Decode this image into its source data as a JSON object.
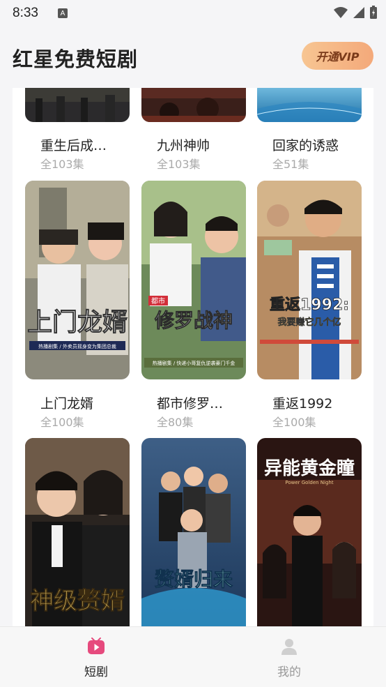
{
  "status_bar": {
    "time": "8:33",
    "notification_icon": "A"
  },
  "header": {
    "title": "红星免费短剧",
    "vip_button": "开通VIP"
  },
  "dramas": [
    {
      "title": "重生后成…",
      "episodes": "全103集"
    },
    {
      "title": "九州神帅",
      "episodes": "全103集"
    },
    {
      "title": "回家的诱惑",
      "episodes": "全51集"
    },
    {
      "title": "上门龙婿",
      "episodes": "全100集",
      "poster_text": "上门龙婿",
      "poster_caption": "热播剧集 / 外卖员摇身变为集团总裁"
    },
    {
      "title": "都市修罗…",
      "episodes": "全80集",
      "poster_text": "修罗战神",
      "poster_badge": "都市",
      "poster_caption": "热播剧集 / 快递小哥复仇逆袭豪门千金"
    },
    {
      "title": "重返1992",
      "episodes": "全100集",
      "poster_text": "重返1992:",
      "poster_sub": "我要赚它几个亿"
    },
    {
      "poster_text": "神级赘婿"
    },
    {
      "poster_text": "赘婿归来"
    },
    {
      "poster_text": "异能黄金瞳",
      "poster_sub": "Power Golden Night"
    }
  ],
  "tab_bar": {
    "tabs": [
      {
        "label": "短剧",
        "active": true
      },
      {
        "label": "我的",
        "active": false
      }
    ]
  },
  "colors": {
    "accent": "#e64a7d",
    "vip_gradient_start": "#f7c592",
    "vip_gradient_end": "#f4a97a",
    "muted_text": "#aaaaaa"
  }
}
